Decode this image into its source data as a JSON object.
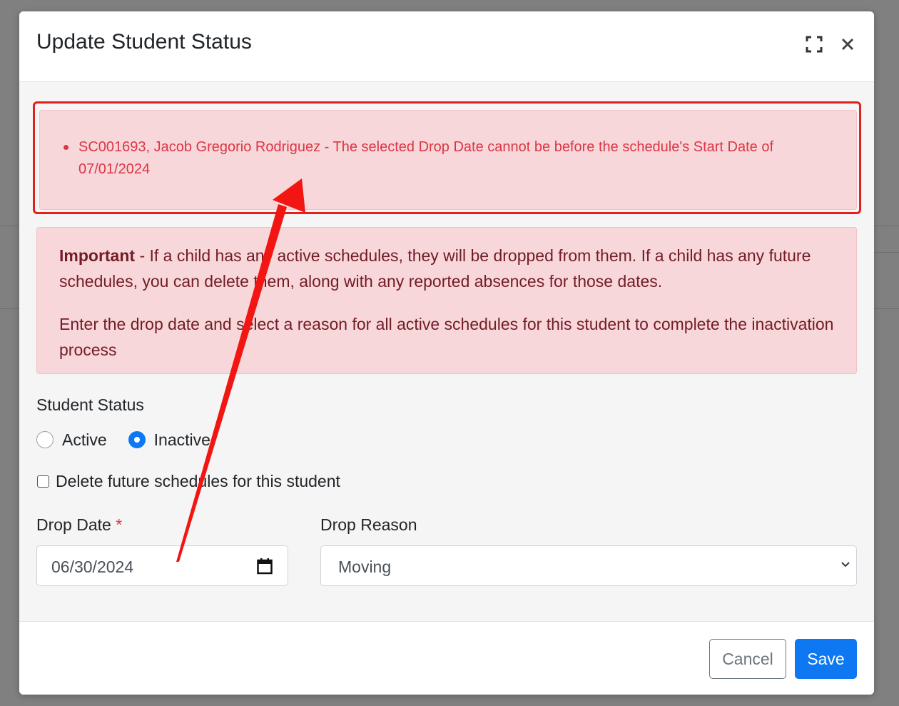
{
  "modal": {
    "title": "Update Student Status"
  },
  "error_alert": {
    "items": [
      "SC001693, Jacob Gregorio Rodriguez - The selected Drop Date cannot be before the schedule's Start Date of 07/01/2024"
    ]
  },
  "info_alert": {
    "important_label": "Important",
    "paragraph1_rest": " - If a child has any active schedules, they will be dropped from them. If a child has any future schedules, you can delete them, along with any reported absences for those dates.",
    "paragraph2": "Enter the drop date and select a reason for all active schedules for this student to complete the inactivation process"
  },
  "student_status": {
    "label": "Student Status",
    "options": [
      {
        "label": "Active",
        "checked": false
      },
      {
        "label": "Inactive",
        "checked": true
      }
    ]
  },
  "delete_future": {
    "label": "Delete future schedules for this student",
    "checked": false
  },
  "drop_date": {
    "label": "Drop Date",
    "required_marker": "*",
    "value": "06/30/2024"
  },
  "drop_reason": {
    "label": "Drop Reason",
    "value": "Moving"
  },
  "footer": {
    "cancel_label": "Cancel",
    "save_label": "Save"
  },
  "colors": {
    "primary": "#0d78f2",
    "error_text": "#dc3545",
    "alert_bg": "#f8d7da",
    "annotation_red": "#e2201c"
  },
  "icons": {
    "expand": "expand-icon",
    "close": "close-icon",
    "calendar": "calendar-icon",
    "chevron": "chevron-down-icon"
  }
}
